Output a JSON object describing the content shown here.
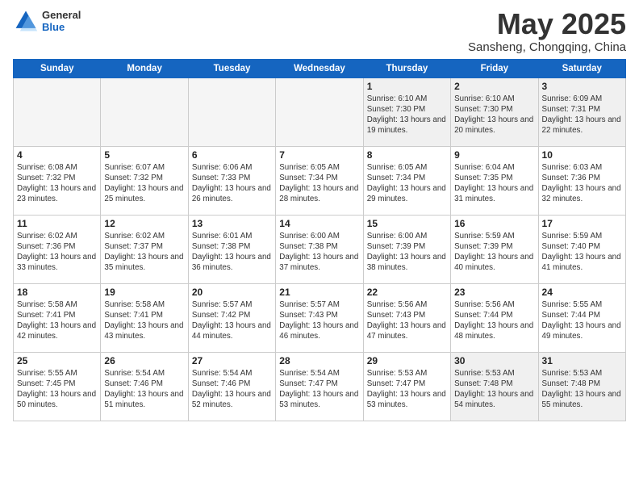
{
  "header": {
    "logo_general": "General",
    "logo_blue": "Blue",
    "title": "May 2025",
    "location": "Sansheng, Chongqing, China"
  },
  "days_of_week": [
    "Sunday",
    "Monday",
    "Tuesday",
    "Wednesday",
    "Thursday",
    "Friday",
    "Saturday"
  ],
  "weeks": [
    [
      {
        "day": "",
        "info": ""
      },
      {
        "day": "",
        "info": ""
      },
      {
        "day": "",
        "info": ""
      },
      {
        "day": "",
        "info": ""
      },
      {
        "day": "1",
        "info": "Sunrise: 6:10 AM\nSunset: 7:30 PM\nDaylight: 13 hours and 19 minutes."
      },
      {
        "day": "2",
        "info": "Sunrise: 6:10 AM\nSunset: 7:30 PM\nDaylight: 13 hours and 20 minutes."
      },
      {
        "day": "3",
        "info": "Sunrise: 6:09 AM\nSunset: 7:31 PM\nDaylight: 13 hours and 22 minutes."
      }
    ],
    [
      {
        "day": "4",
        "info": "Sunrise: 6:08 AM\nSunset: 7:32 PM\nDaylight: 13 hours and 23 minutes."
      },
      {
        "day": "5",
        "info": "Sunrise: 6:07 AM\nSunset: 7:32 PM\nDaylight: 13 hours and 25 minutes."
      },
      {
        "day": "6",
        "info": "Sunrise: 6:06 AM\nSunset: 7:33 PM\nDaylight: 13 hours and 26 minutes."
      },
      {
        "day": "7",
        "info": "Sunrise: 6:05 AM\nSunset: 7:34 PM\nDaylight: 13 hours and 28 minutes."
      },
      {
        "day": "8",
        "info": "Sunrise: 6:05 AM\nSunset: 7:34 PM\nDaylight: 13 hours and 29 minutes."
      },
      {
        "day": "9",
        "info": "Sunrise: 6:04 AM\nSunset: 7:35 PM\nDaylight: 13 hours and 31 minutes."
      },
      {
        "day": "10",
        "info": "Sunrise: 6:03 AM\nSunset: 7:36 PM\nDaylight: 13 hours and 32 minutes."
      }
    ],
    [
      {
        "day": "11",
        "info": "Sunrise: 6:02 AM\nSunset: 7:36 PM\nDaylight: 13 hours and 33 minutes."
      },
      {
        "day": "12",
        "info": "Sunrise: 6:02 AM\nSunset: 7:37 PM\nDaylight: 13 hours and 35 minutes."
      },
      {
        "day": "13",
        "info": "Sunrise: 6:01 AM\nSunset: 7:38 PM\nDaylight: 13 hours and 36 minutes."
      },
      {
        "day": "14",
        "info": "Sunrise: 6:00 AM\nSunset: 7:38 PM\nDaylight: 13 hours and 37 minutes."
      },
      {
        "day": "15",
        "info": "Sunrise: 6:00 AM\nSunset: 7:39 PM\nDaylight: 13 hours and 38 minutes."
      },
      {
        "day": "16",
        "info": "Sunrise: 5:59 AM\nSunset: 7:39 PM\nDaylight: 13 hours and 40 minutes."
      },
      {
        "day": "17",
        "info": "Sunrise: 5:59 AM\nSunset: 7:40 PM\nDaylight: 13 hours and 41 minutes."
      }
    ],
    [
      {
        "day": "18",
        "info": "Sunrise: 5:58 AM\nSunset: 7:41 PM\nDaylight: 13 hours and 42 minutes."
      },
      {
        "day": "19",
        "info": "Sunrise: 5:58 AM\nSunset: 7:41 PM\nDaylight: 13 hours and 43 minutes."
      },
      {
        "day": "20",
        "info": "Sunrise: 5:57 AM\nSunset: 7:42 PM\nDaylight: 13 hours and 44 minutes."
      },
      {
        "day": "21",
        "info": "Sunrise: 5:57 AM\nSunset: 7:43 PM\nDaylight: 13 hours and 46 minutes."
      },
      {
        "day": "22",
        "info": "Sunrise: 5:56 AM\nSunset: 7:43 PM\nDaylight: 13 hours and 47 minutes."
      },
      {
        "day": "23",
        "info": "Sunrise: 5:56 AM\nSunset: 7:44 PM\nDaylight: 13 hours and 48 minutes."
      },
      {
        "day": "24",
        "info": "Sunrise: 5:55 AM\nSunset: 7:44 PM\nDaylight: 13 hours and 49 minutes."
      }
    ],
    [
      {
        "day": "25",
        "info": "Sunrise: 5:55 AM\nSunset: 7:45 PM\nDaylight: 13 hours and 50 minutes."
      },
      {
        "day": "26",
        "info": "Sunrise: 5:54 AM\nSunset: 7:46 PM\nDaylight: 13 hours and 51 minutes."
      },
      {
        "day": "27",
        "info": "Sunrise: 5:54 AM\nSunset: 7:46 PM\nDaylight: 13 hours and 52 minutes."
      },
      {
        "day": "28",
        "info": "Sunrise: 5:54 AM\nSunset: 7:47 PM\nDaylight: 13 hours and 53 minutes."
      },
      {
        "day": "29",
        "info": "Sunrise: 5:53 AM\nSunset: 7:47 PM\nDaylight: 13 hours and 53 minutes."
      },
      {
        "day": "30",
        "info": "Sunrise: 5:53 AM\nSunset: 7:48 PM\nDaylight: 13 hours and 54 minutes."
      },
      {
        "day": "31",
        "info": "Sunrise: 5:53 AM\nSunset: 7:48 PM\nDaylight: 13 hours and 55 minutes."
      }
    ]
  ]
}
